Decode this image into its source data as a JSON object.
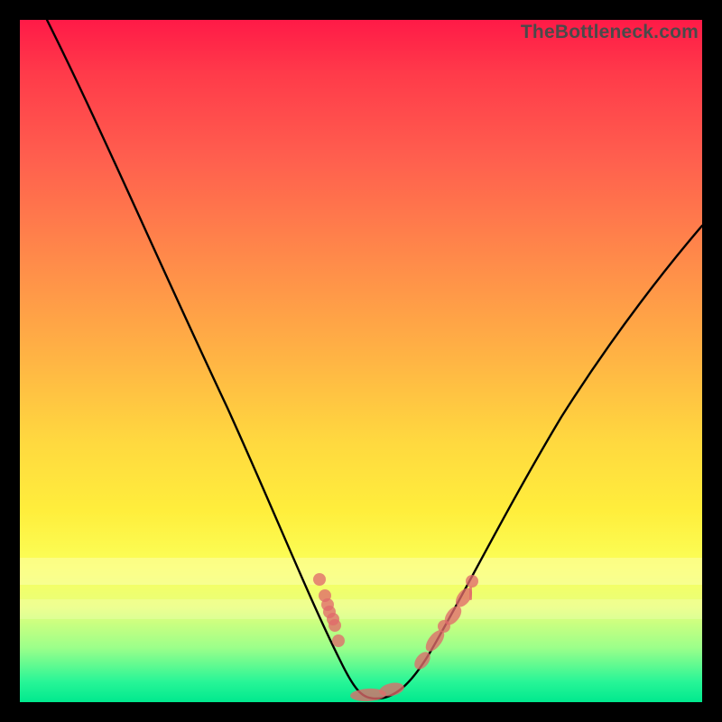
{
  "watermark": "TheBottleneck.com",
  "chart_data": {
    "type": "line",
    "title": "",
    "xlabel": "",
    "ylabel": "",
    "xlim": [
      0,
      100
    ],
    "ylim": [
      0,
      100
    ],
    "grid": false,
    "legend": false,
    "series": [
      {
        "name": "bottleneck-curve",
        "x": [
          4,
          10,
          17,
          24,
          31,
          38,
          44,
          47,
          49,
          50,
          51,
          53,
          55,
          58,
          63,
          70,
          78,
          86,
          94,
          100
        ],
        "y": [
          100,
          87,
          73,
          59,
          45,
          31,
          18,
          10,
          5,
          2,
          1,
          1,
          2,
          5,
          12,
          22,
          34,
          46,
          57,
          65
        ]
      }
    ],
    "markers": {
      "name": "highlighted-points",
      "color": "#e06a6a",
      "points": [
        {
          "x": 44.0,
          "y": 18.0
        },
        {
          "x": 45.1,
          "y": 15.4
        },
        {
          "x": 45.2,
          "y": 14.2
        },
        {
          "x": 45.7,
          "y": 13.4
        },
        {
          "x": 46.0,
          "y": 12.5
        },
        {
          "x": 46.2,
          "y": 11.5
        },
        {
          "x": 47.0,
          "y": 9.0
        },
        {
          "x": 51.0,
          "y": 1.0,
          "shape": "pill",
          "len": 4.2
        },
        {
          "x": 54.0,
          "y": 2.0,
          "shape": "pill",
          "len": 3.1
        },
        {
          "x": 58.8,
          "y": 6.5,
          "shape": "pill",
          "len": 2.4
        },
        {
          "x": 60.6,
          "y": 9.7
        },
        {
          "x": 62.6,
          "y": 11.4,
          "shape": "pill",
          "len": 3.1
        },
        {
          "x": 64.5,
          "y": 14.2,
          "shape": "pill",
          "len": 2.6
        },
        {
          "x": 66.2,
          "y": 17.5
        }
      ]
    },
    "bands": [
      {
        "y0": 79,
        "y1": 83,
        "alpha": 0.25
      },
      {
        "y0": 85,
        "y1": 88,
        "alpha": 0.2
      }
    ]
  }
}
